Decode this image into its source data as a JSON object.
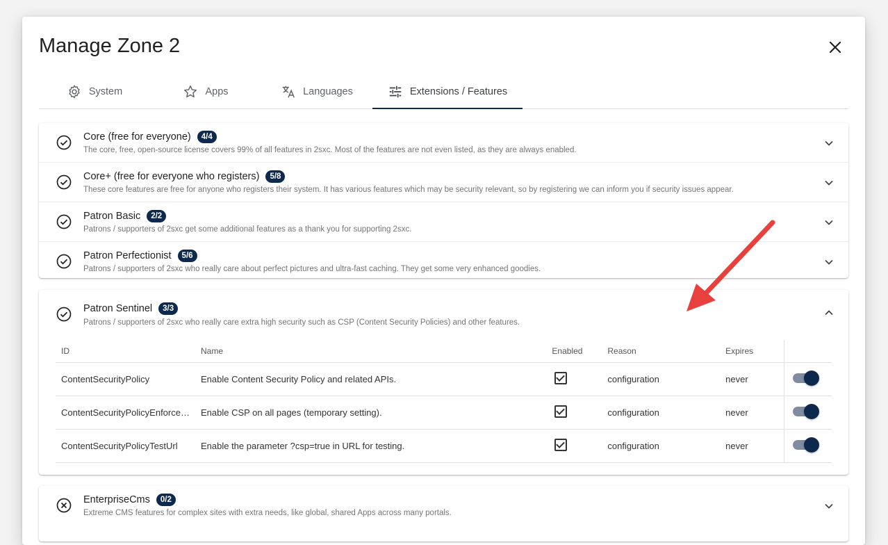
{
  "dialog": {
    "title": "Manage Zone 2",
    "close_icon": "close-icon"
  },
  "tabs": [
    {
      "label": "System",
      "icon": "gear-icon",
      "active": false
    },
    {
      "label": "Apps",
      "icon": "star-icon",
      "active": false
    },
    {
      "label": "Languages",
      "icon": "translate-icon",
      "active": false
    },
    {
      "label": "Extensions / Features",
      "icon": "tune-icon",
      "active": true
    }
  ],
  "feature_groups": [
    {
      "name": "Core (free for everyone)",
      "count": "4/4",
      "description": "The core, free, open-source license covers 99% of all features in 2sxc. Most of the features are not even listed, as they are always enabled.",
      "status": "enabled"
    },
    {
      "name": "Core+ (free for everyone who registers)",
      "count": "5/8",
      "description": "These core features are free for anyone who registers their system. It has various features which may be security relevant, so by registering we can inform you if security issues appear.",
      "status": "enabled"
    },
    {
      "name": "Patron Basic",
      "count": "2/2",
      "description": "Patrons / supporters of 2sxc get some additional features as a thank you for supporting 2sxc.",
      "status": "enabled"
    },
    {
      "name": "Patron Perfectionist",
      "count": "5/6",
      "description": "Patrons / supporters of 2sxc who really care about perfect pictures and ultra-fast caching. They get some very enhanced goodies.",
      "status": "enabled"
    }
  ],
  "expanded_group": {
    "name": "Patron Sentinel",
    "count": "3/3",
    "description": "Patrons / supporters of 2sxc who really care extra high security such as CSP (Content Security Policies) and other features.",
    "status": "enabled",
    "columns": {
      "id": "ID",
      "name": "Name",
      "enabled": "Enabled",
      "reason": "Reason",
      "expires": "Expires"
    },
    "rows": [
      {
        "id": "ContentSecurityPolicy",
        "name": "Enable Content Security Policy and related APIs.",
        "enabled": true,
        "reason": "configuration",
        "expires": "never",
        "toggle_on": true
      },
      {
        "id": "ContentSecurityPolicyEnforce…",
        "name": "Enable CSP on all pages (temporary setting).",
        "enabled": true,
        "reason": "configuration",
        "expires": "never",
        "toggle_on": true
      },
      {
        "id": "ContentSecurityPolicyTestUrl",
        "name": "Enable the parameter ?csp=true in URL for testing.",
        "enabled": true,
        "reason": "configuration",
        "expires": "never",
        "toggle_on": true
      }
    ]
  },
  "bottom_group": {
    "name": "EnterpriseCms",
    "count": "0/2",
    "description": "Extreme CMS features for complex sites with extra needs, like global, shared Apps across many portals.",
    "status": "disabled"
  },
  "colors": {
    "accent": "#0d2a4e",
    "arrow": "#e8403c",
    "toggle_track": "#7d8ca3"
  }
}
